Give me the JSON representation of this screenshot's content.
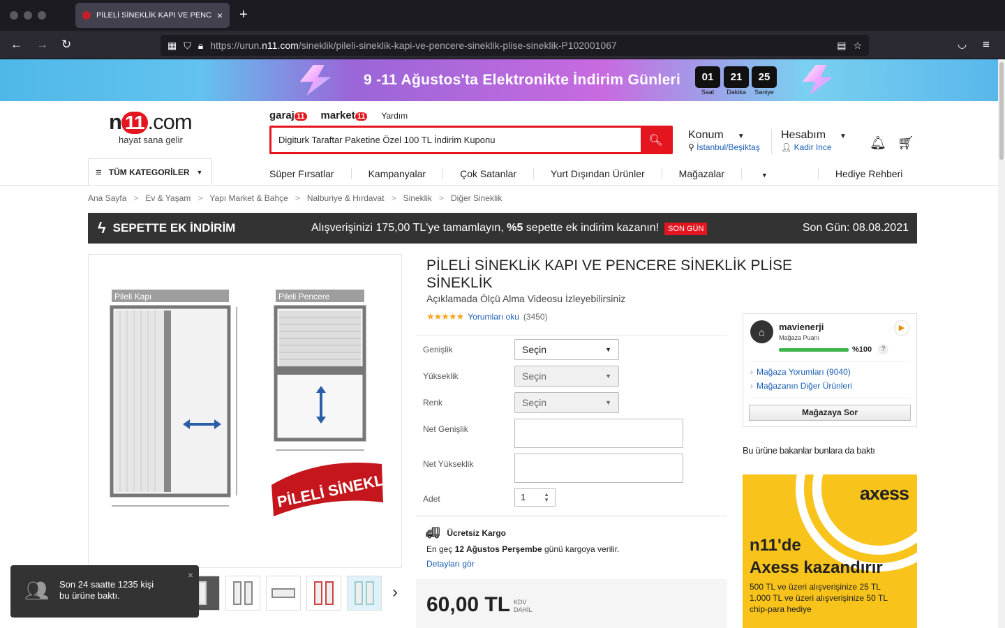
{
  "browser": {
    "tab_title": "PİLELİ SİNEKLİK KAPI VE PENCERE",
    "tab_close": "×",
    "new_tab": "+",
    "url_prefix": "https://urun.",
    "url_domain": "n11.com",
    "url_path": "/sineklik/pileli-sineklik-kapi-ve-pencere-sineklik-plise-sineklik-P102001067"
  },
  "promo": {
    "text": "9 -11 Ağustos'ta Elektronikte İndirim Günleri",
    "countdown": [
      {
        "value": "01",
        "label": "Saat"
      },
      {
        "value": "21",
        "label": "Dakika"
      },
      {
        "value": "25",
        "label": "Saniye"
      }
    ]
  },
  "header": {
    "logo_n": "n",
    "logo_11": "11",
    "logo_com": ".com",
    "slogan": "hayat sana gelir",
    "garaj": "garaj",
    "garaj_badge": "11",
    "market": "market",
    "market_badge": "11",
    "help": "Yardım",
    "search_value": "Digiturk Taraftar Paketine Özel 100 TL İndirim Kuponu",
    "location_label": "Konum",
    "location_value": "İstanbul/Beşiktaş",
    "account_label": "Hesabım",
    "account_value": "Kadir Ince",
    "categories_btn": "TÜM KATEGORİLER"
  },
  "nav": [
    "Süper Fırsatlar",
    "Kampanyalar",
    "Çok Satanlar",
    "Yurt Dışından Ürünler",
    "Mağazalar",
    "Hediye Rehberi"
  ],
  "breadcrumb": [
    "Ana Sayfa",
    "Ev & Yaşam",
    "Yapı Market & Bahçe",
    "Nalburiye & Hırdavat",
    "Sineklik",
    "Diğer Sineklik"
  ],
  "sepette": {
    "title": "SEPETTE EK İNDİRİM",
    "message_pre": "Alışverişinizi 175,00 TL'ye tamamlayın, ",
    "message_bold": "%5",
    "message_post": " sepette ek indirim kazanın!",
    "badge": "SON GÜN",
    "last_day": "Son Gün: 08.08.2021"
  },
  "product": {
    "title": "PİLELİ SİNEKLİK KAPI VE PENCERE SİNEKLİK PLİSE SİNEKLİK",
    "subtitle": "Açıklamada Ölçü Alma Videosu İzleyebilirsiniz",
    "rating_stars": 5,
    "reviews_link": "Yorumları oku",
    "review_count": "(3450)",
    "image_labels": {
      "door": "Pileli Kapı",
      "window": "Pileli Pencere",
      "ribbon": "PİLELİ SİNEKLİK"
    },
    "options": {
      "width_label": "Genişlik",
      "height_label": "Yükseklik",
      "color_label": "Renk",
      "select_placeholder": "Seçin",
      "net_width_label": "Net Genişlik",
      "net_height_label": "Net Yükseklik",
      "qty_label": "Adet",
      "qty_value": "1"
    },
    "shipping": {
      "title": "Ücretsiz Kargo",
      "detail_pre": "En geç ",
      "detail_bold": "12 Ağustos Perşembe",
      "detail_post": " günü kargoya verilir.",
      "link": "Detayları gör"
    },
    "price": "60,00 TL",
    "vat_1": "KDV",
    "vat_2": "DAHİL"
  },
  "seller": {
    "name": "mavienerji",
    "score_label": "Mağaza Puanı",
    "score": "%100",
    "score_fraction": 1.0,
    "help": "?",
    "reviews_link": "Mağaza Yorumları (9040)",
    "other_products_link": "Mağazanın Diğer Ürünleri",
    "ask_btn": "Mağazaya Sor"
  },
  "also_viewed": "Bu ürüne bakanlar bunlara da baktı",
  "ad": {
    "brand": "axess",
    "line1": "n11'de",
    "line2": "Axess kazandırır",
    "sub1": "500 TL ve üzeri alışverişinize 25 TL",
    "sub2": "1.000 TL ve üzeri alışverişinize 50 TL",
    "sub3": "chip-para hediye"
  },
  "toast": {
    "line1": "Son 24 saatte 1235 kişi",
    "line2": "bu ürüne baktı.",
    "close": "×"
  }
}
